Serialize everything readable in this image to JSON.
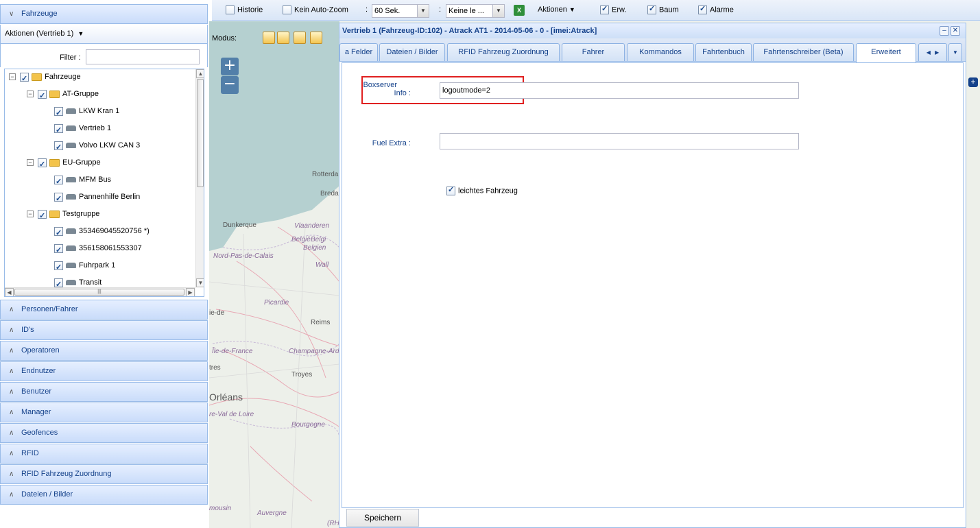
{
  "left_panel": {
    "title": "Fahrzeuge",
    "aktionen": "Aktionen (Vertrieb 1)",
    "filter_label": "Filter :",
    "filter_value": "",
    "tree": [
      {
        "label": "Fahrzeuge",
        "level": 0,
        "type": "folder",
        "expander": "⊟"
      },
      {
        "label": "AT-Gruppe",
        "level": 1,
        "type": "folder",
        "expander": "⊟"
      },
      {
        "label": "LKW Kran 1",
        "level": 2,
        "type": "vehicle"
      },
      {
        "label": "Vertrieb 1",
        "level": 2,
        "type": "vehicle"
      },
      {
        "label": "Volvo LKW CAN 3",
        "level": 2,
        "type": "vehicle"
      },
      {
        "label": "EU-Gruppe",
        "level": 1,
        "type": "folder",
        "expander": "⊟"
      },
      {
        "label": "MFM Bus",
        "level": 2,
        "type": "vehicle"
      },
      {
        "label": "Pannenhilfe Berlin",
        "level": 2,
        "type": "vehicle"
      },
      {
        "label": "Testgruppe",
        "level": 1,
        "type": "folder",
        "expander": "⊟"
      },
      {
        "label": "353469045520756 *)",
        "level": 2,
        "type": "vehicle"
      },
      {
        "label": "356158061553307",
        "level": 2,
        "type": "vehicle"
      },
      {
        "label": "Fuhrpark 1",
        "level": 2,
        "type": "vehicle"
      },
      {
        "label": "Transit",
        "level": 2,
        "type": "vehicle"
      }
    ],
    "sections": [
      "Personen/Fahrer",
      "ID's",
      "Operatoren",
      "Endnutzer",
      "Benutzer",
      "Manager",
      "Geofences",
      "RFID",
      "RFID Fahrzeug Zuordnung",
      "Dateien / Bilder"
    ]
  },
  "toolbar": {
    "historie": "Historie",
    "kein_auto_zoom": "Kein Auto-Zoom",
    "interval": "60 Sek.",
    "keine": "Keine le ...",
    "aktionen": "Aktionen",
    "erw": "Erw.",
    "baum": "Baum",
    "alarme": "Alarme"
  },
  "map": {
    "modus_label": "Modus:",
    "zoom_in": "+",
    "zoom_out": "−",
    "labels": [
      "Rotterdam",
      "Breda",
      "Dunkerque",
      "Vlaanderen",
      "België",
      "Belgi",
      "Belgien",
      "Nord-Pas-de-Calais",
      "Wall",
      "Picardie",
      "Reims",
      "Île-de-France",
      "Champagne-Ard",
      "Troyes",
      "Orléans",
      "Bourgogne",
      "Auvergne",
      "ie-de",
      "tres",
      "re-Val de Loire",
      "mousin",
      "(RH"
    ]
  },
  "dialog": {
    "title": "Vertrieb 1 (Fahrzeug-ID:102) - Atrack AT1 - 2014-05-06 - 0 - [imei:Atrack]",
    "tabs": [
      "a Felder",
      "Dateien / Bilder",
      "RFID Fahrzeug Zuordnung",
      "Fahrer",
      "Kommandos",
      "Fahrtenbuch",
      "Fahrtenschreiber (Beta)",
      "Erweitert"
    ],
    "boxserver_label_1": "Boxserver",
    "boxserver_label_2": "Info :",
    "boxserver_value": "logoutmode=2",
    "fuel_label": "Fuel Extra :",
    "fuel_value": "",
    "leichtes_label": "leichtes Fahrzeug",
    "save": "Speichern"
  }
}
